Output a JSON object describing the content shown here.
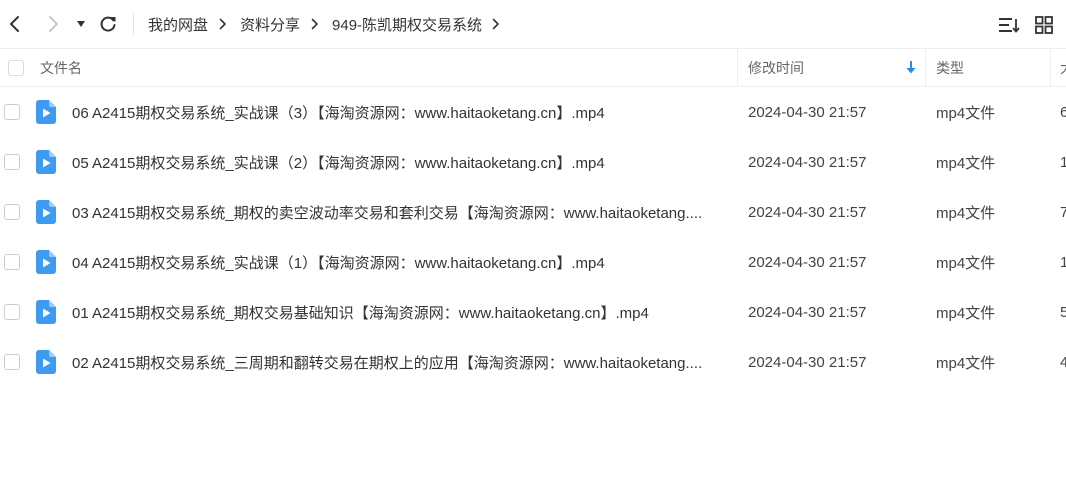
{
  "breadcrumb": [
    "我的网盘",
    "资料分享",
    "949-陈凯期权交易系统"
  ],
  "columns": {
    "name": "文件名",
    "modified": "修改时间",
    "type": "类型",
    "size": "大"
  },
  "files": [
    {
      "name": "06 A2415期权交易系统_实战课（3）【海淘资源网：www.haitaoketang.cn】.mp4",
      "modified": "2024-04-30 21:57",
      "type": "mp4文件",
      "size": "6"
    },
    {
      "name": "05 A2415期权交易系统_实战课（2）【海淘资源网：www.haitaoketang.cn】.mp4",
      "modified": "2024-04-30 21:57",
      "type": "mp4文件",
      "size": "1"
    },
    {
      "name": "03 A2415期权交易系统_期权的卖空波动率交易和套利交易【海淘资源网：www.haitaoketang....",
      "modified": "2024-04-30 21:57",
      "type": "mp4文件",
      "size": "7"
    },
    {
      "name": "04 A2415期权交易系统_实战课（1）【海淘资源网：www.haitaoketang.cn】.mp4",
      "modified": "2024-04-30 21:57",
      "type": "mp4文件",
      "size": "1"
    },
    {
      "name": "01 A2415期权交易系统_期权交易基础知识【海淘资源网：www.haitaoketang.cn】.mp4",
      "modified": "2024-04-30 21:57",
      "type": "mp4文件",
      "size": "5"
    },
    {
      "name": "02 A2415期权交易系统_三周期和翻转交易在期权上的应用【海淘资源网：www.haitaoketang....",
      "modified": "2024-04-30 21:57",
      "type": "mp4文件",
      "size": "4"
    }
  ],
  "icons": {
    "back": "chevron-left-icon",
    "forward": "chevron-right-icon",
    "dropdown": "caret-down-icon",
    "refresh": "refresh-icon",
    "sort_list": "sort-list-icon",
    "grid_view": "grid-view-icon",
    "sort_direction": "arrow-down-icon",
    "file": "video-file-icon"
  },
  "colors": {
    "accent": "#2b8cf0",
    "file_icon": "#3f9bf2",
    "text": "#333333",
    "muted": "#666666",
    "disabled": "#c8c8c8"
  }
}
